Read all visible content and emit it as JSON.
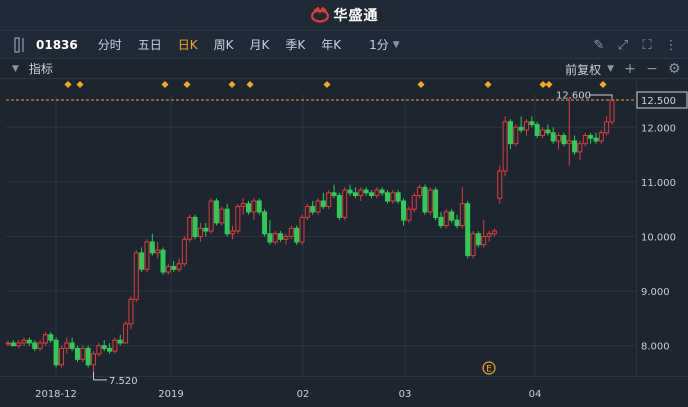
{
  "app": {
    "brand_name": "华盛通",
    "icons": {
      "logo": "huasheng-logo-icon",
      "split": "split-panel-icon"
    }
  },
  "toolbar": {
    "stock_code": "01836",
    "tabs": [
      "分时",
      "五日",
      "日K",
      "周K",
      "月K",
      "季K",
      "年K"
    ],
    "active_tab": "日K",
    "interval": "1分",
    "right_icons": [
      "pencil-icon",
      "expand-icon",
      "fullscreen-icon",
      "more-icon"
    ]
  },
  "indicator_bar": {
    "label": "指标",
    "adjust_label": "前复权",
    "right_icons": [
      "plus-icon",
      "minus-icon",
      "gear-icon"
    ]
  },
  "colors": {
    "up": "#e23b3b",
    "down": "#2ecc56",
    "dot": "#f5a623",
    "price_line": "#f5a623",
    "grid": "#2b3644"
  },
  "chart_data": {
    "type": "candlestick",
    "y_ticks": [
      "12.500",
      "12.000",
      "11.000",
      "10.000",
      "9.000",
      "8.000"
    ],
    "ylim": [
      7.5,
      12.65
    ],
    "x_labels": [
      "2018-12",
      "2019",
      "02",
      "03",
      "04"
    ],
    "current_price": "12.500",
    "max_label": "12.600",
    "min_label": "7.520",
    "event_marker": "E",
    "dividend_dots": 14,
    "candles": [
      [
        8.05,
        8.1,
        8.0,
        8.05
      ],
      [
        8.05,
        8.1,
        8.0,
        8.0
      ],
      [
        8.0,
        8.1,
        7.95,
        8.05
      ],
      [
        8.05,
        8.15,
        8.0,
        8.1
      ],
      [
        8.1,
        8.15,
        8.0,
        8.05
      ],
      [
        8.05,
        8.1,
        7.9,
        7.95
      ],
      [
        7.95,
        8.1,
        7.9,
        8.05
      ],
      [
        8.05,
        8.25,
        8.0,
        8.2
      ],
      [
        8.2,
        8.25,
        8.05,
        8.1
      ],
      [
        8.1,
        8.15,
        7.6,
        7.65
      ],
      [
        7.65,
        8.0,
        7.6,
        7.95
      ],
      [
        7.95,
        8.15,
        7.85,
        8.05
      ],
      [
        8.05,
        8.15,
        7.9,
        7.95
      ],
      [
        7.95,
        8.0,
        7.7,
        7.75
      ],
      [
        7.75,
        8.0,
        7.7,
        7.95
      ],
      [
        7.95,
        8.0,
        7.6,
        7.65
      ],
      [
        7.65,
        7.9,
        7.52,
        7.85
      ],
      [
        7.85,
        8.05,
        7.8,
        8.0
      ],
      [
        8.0,
        8.1,
        7.9,
        7.95
      ],
      [
        7.95,
        8.05,
        7.85,
        7.9
      ],
      [
        7.9,
        8.15,
        7.85,
        8.1
      ],
      [
        8.1,
        8.2,
        8.0,
        8.05
      ],
      [
        8.05,
        8.45,
        8.05,
        8.4
      ],
      [
        8.4,
        8.9,
        8.3,
        8.85
      ],
      [
        8.85,
        9.75,
        8.8,
        9.7
      ],
      [
        9.7,
        9.8,
        9.35,
        9.4
      ],
      [
        9.4,
        9.95,
        9.35,
        9.9
      ],
      [
        9.9,
        10.05,
        9.65,
        9.7
      ],
      [
        9.7,
        9.9,
        9.6,
        9.75
      ],
      [
        9.75,
        9.8,
        9.3,
        9.35
      ],
      [
        9.35,
        9.5,
        9.3,
        9.45
      ],
      [
        9.45,
        9.55,
        9.35,
        9.4
      ],
      [
        9.4,
        9.6,
        9.35,
        9.5
      ],
      [
        9.5,
        10.0,
        9.45,
        9.95
      ],
      [
        9.95,
        10.4,
        9.9,
        10.35
      ],
      [
        10.35,
        10.4,
        9.95,
        10.0
      ],
      [
        10.0,
        10.25,
        9.9,
        10.15
      ],
      [
        10.15,
        10.25,
        10.0,
        10.1
      ],
      [
        10.1,
        10.7,
        10.05,
        10.65
      ],
      [
        10.65,
        10.7,
        10.2,
        10.25
      ],
      [
        10.25,
        10.55,
        10.2,
        10.5
      ],
      [
        10.5,
        10.6,
        10.0,
        10.05
      ],
      [
        10.05,
        10.2,
        9.95,
        10.1
      ],
      [
        10.1,
        10.6,
        10.05,
        10.55
      ],
      [
        10.55,
        10.7,
        10.4,
        10.6
      ],
      [
        10.6,
        10.65,
        10.4,
        10.45
      ],
      [
        10.45,
        10.7,
        10.3,
        10.65
      ],
      [
        10.65,
        10.7,
        10.4,
        10.45
      ],
      [
        10.45,
        10.5,
        10.0,
        10.05
      ],
      [
        10.05,
        10.3,
        9.85,
        9.9
      ],
      [
        9.9,
        10.1,
        9.85,
        10.05
      ],
      [
        10.05,
        10.1,
        9.9,
        9.95
      ],
      [
        9.95,
        10.05,
        9.85,
        10.0
      ],
      [
        10.0,
        10.2,
        9.95,
        10.15
      ],
      [
        10.15,
        10.2,
        9.85,
        9.9
      ],
      [
        9.9,
        10.4,
        9.85,
        10.35
      ],
      [
        10.35,
        10.6,
        10.3,
        10.55
      ],
      [
        10.55,
        10.65,
        10.4,
        10.45
      ],
      [
        10.45,
        10.7,
        10.4,
        10.65
      ],
      [
        10.65,
        10.8,
        10.5,
        10.55
      ],
      [
        10.55,
        10.85,
        10.5,
        10.8
      ],
      [
        10.8,
        10.95,
        10.7,
        10.75
      ],
      [
        10.75,
        10.8,
        10.3,
        10.35
      ],
      [
        10.35,
        10.9,
        10.3,
        10.85
      ],
      [
        10.85,
        10.95,
        10.75,
        10.8
      ],
      [
        10.8,
        10.9,
        10.7,
        10.75
      ],
      [
        10.75,
        10.9,
        10.65,
        10.85
      ],
      [
        10.85,
        10.9,
        10.75,
        10.8
      ],
      [
        10.8,
        10.85,
        10.7,
        10.75
      ],
      [
        10.75,
        10.9,
        10.7,
        10.85
      ],
      [
        10.85,
        10.9,
        10.75,
        10.8
      ],
      [
        10.8,
        10.85,
        10.6,
        10.65
      ],
      [
        10.65,
        10.85,
        10.6,
        10.8
      ],
      [
        10.8,
        10.85,
        10.6,
        10.65
      ],
      [
        10.65,
        10.7,
        10.2,
        10.3
      ],
      [
        10.3,
        10.55,
        10.25,
        10.5
      ],
      [
        10.5,
        10.8,
        10.45,
        10.75
      ],
      [
        10.75,
        10.95,
        10.7,
        10.9
      ],
      [
        10.9,
        10.95,
        10.4,
        10.45
      ],
      [
        10.45,
        10.9,
        10.4,
        10.85
      ],
      [
        10.85,
        10.9,
        10.3,
        10.35
      ],
      [
        10.35,
        10.45,
        10.15,
        10.2
      ],
      [
        10.2,
        10.5,
        10.15,
        10.45
      ],
      [
        10.45,
        10.5,
        10.25,
        10.3
      ],
      [
        10.3,
        10.4,
        10.15,
        10.2
      ],
      [
        10.2,
        10.9,
        10.15,
        10.6
      ],
      [
        10.6,
        10.65,
        9.6,
        9.65
      ],
      [
        9.65,
        10.1,
        9.6,
        10.05
      ],
      [
        10.05,
        10.1,
        9.8,
        9.85
      ],
      [
        9.85,
        10.3,
        9.8,
        10.0
      ],
      [
        10.0,
        10.1,
        9.9,
        10.05
      ],
      [
        10.05,
        10.15,
        10.0,
        10.1
      ],
      [
        10.7,
        11.3,
        10.6,
        11.2
      ],
      [
        11.2,
        12.2,
        11.1,
        12.1
      ],
      [
        12.1,
        12.15,
        11.6,
        11.7
      ],
      [
        11.7,
        12.05,
        11.65,
        12.0
      ],
      [
        12.0,
        12.2,
        11.9,
        11.95
      ],
      [
        11.95,
        12.15,
        11.85,
        12.1
      ],
      [
        12.1,
        12.2,
        12.0,
        12.05
      ],
      [
        12.05,
        12.1,
        11.8,
        11.85
      ],
      [
        11.85,
        12.0,
        11.8,
        11.95
      ],
      [
        11.95,
        12.05,
        11.85,
        11.9
      ],
      [
        11.9,
        12.0,
        11.7,
        11.75
      ],
      [
        11.75,
        11.9,
        11.6,
        11.85
      ],
      [
        11.85,
        11.9,
        11.65,
        11.7
      ],
      [
        11.7,
        12.55,
        11.3,
        11.75
      ],
      [
        11.75,
        11.85,
        11.5,
        11.55
      ],
      [
        11.55,
        11.75,
        11.4,
        11.7
      ],
      [
        11.7,
        11.9,
        11.65,
        11.85
      ],
      [
        11.85,
        11.9,
        11.7,
        11.8
      ],
      [
        11.8,
        11.9,
        11.7,
        11.75
      ],
      [
        11.75,
        11.95,
        11.7,
        11.9
      ],
      [
        11.9,
        12.2,
        11.85,
        12.1
      ],
      [
        12.1,
        12.6,
        12.05,
        12.5
      ]
    ]
  }
}
